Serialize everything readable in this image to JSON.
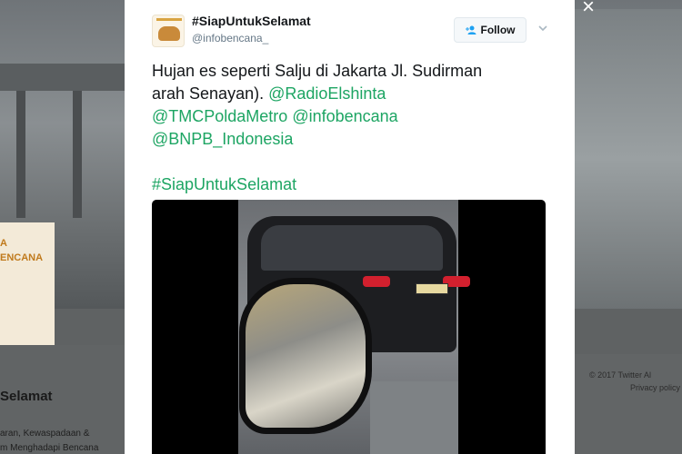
{
  "background": {
    "profile_banner_line1": "A",
    "profile_banner_line2": "ENCANA",
    "profile_name": "Selamat",
    "profile_bio_line1": "aran, Kewaspadaan &",
    "profile_bio_line2": "m Menghadapi Bencana",
    "footer_line1": "© 2017 Twitter   Al",
    "footer_line2": "Privacy policy"
  },
  "modal": {
    "close_icon": "×"
  },
  "tweet": {
    "user_name": "#SiapUntukSelamat",
    "user_handle": "@infobencana_",
    "follow_label": "Follow",
    "text_line1": "Hujan es seperti Salju di Jakarta Jl. Sudirman",
    "text_line2_plain": "arah Senayan). ",
    "mention1": "@RadioElshinta",
    "mention2": "@TMCPoldaMetro",
    "mention3": "@infobencana",
    "mention4": "@BNPB_Indonesia",
    "hashtag": "#SiapUntukSelamat"
  },
  "colors": {
    "link": "#1da563",
    "text": "#14171a",
    "muted": "#657786"
  },
  "icons": {
    "follow": "add-user-icon",
    "caret": "chevron-down-icon",
    "close": "close-icon"
  }
}
